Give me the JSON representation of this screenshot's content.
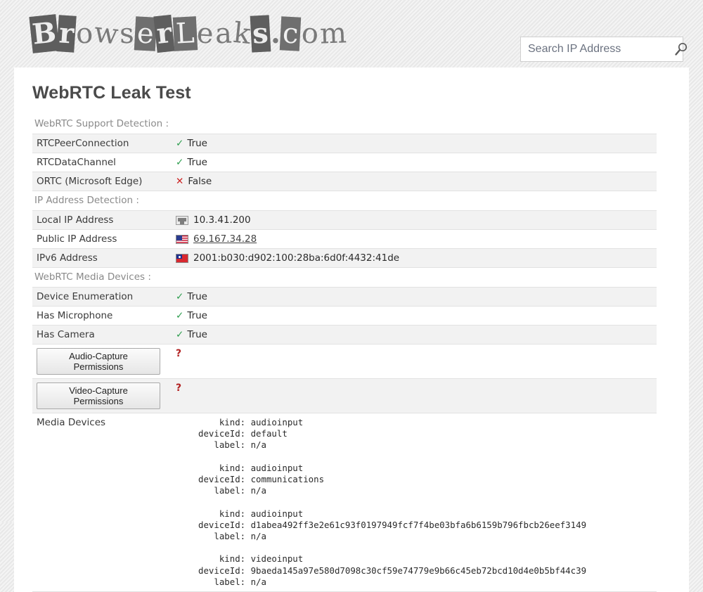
{
  "header": {
    "logo_text": "BrowserLeaks.com",
    "logo_chars": [
      "B",
      "r",
      "o",
      "w",
      "s",
      "e",
      "r",
      "L",
      "e",
      "a",
      "k",
      "s",
      ".",
      "c",
      "o",
      "m"
    ],
    "search": {
      "placeholder": "Search IP Address",
      "value": "",
      "icon": "search-icon"
    }
  },
  "main": {
    "title": "WebRTC Leak Test",
    "sections": [
      {
        "label": "WebRTC Support Detection :",
        "rows": [
          {
            "key": "RTCPeerConnection",
            "status": "true",
            "value": "True"
          },
          {
            "key": "RTCDataChannel",
            "status": "true",
            "value": "True"
          },
          {
            "key": "ORTC (Microsoft Edge)",
            "status": "false",
            "value": "False"
          }
        ]
      },
      {
        "label": "IP Address Detection :",
        "rows": [
          {
            "key": "Local IP Address",
            "icon": "lan-icon",
            "value": "10.3.41.200",
            "link": false
          },
          {
            "key": "Public IP Address",
            "icon": "flag-us-icon",
            "value": "69.167.34.28",
            "link": true
          },
          {
            "key": "IPv6 Address",
            "icon": "flag-tw-icon",
            "value": "2001:b030:d902:100:28ba:6d0f:4432:41de",
            "link": false
          }
        ]
      },
      {
        "label": "WebRTC Media Devices :",
        "rows": [
          {
            "key": "Device Enumeration",
            "status": "true",
            "value": "True"
          },
          {
            "key": "Has Microphone",
            "status": "true",
            "value": "True"
          },
          {
            "key": "Has Camera",
            "status": "true",
            "value": "True"
          }
        ]
      }
    ],
    "permissions": [
      {
        "button_label": "Audio-Capture Permissions",
        "status_symbol": "?"
      },
      {
        "button_label": "Video-Capture Permissions",
        "status_symbol": "?"
      }
    ],
    "media_devices": {
      "key": "Media Devices",
      "text": "    kind: audioinput\ndeviceId: default\n   label: n/a\n\n    kind: audioinput\ndeviceId: communications\n   label: n/a\n\n    kind: audioinput\ndeviceId: d1abea492ff3e2e61c93f0197949fcf7f4be03bfa6b6159b796fbcb26eef3149\n   label: n/a\n\n    kind: videoinput\ndeviceId: 9baeda145a97e580d7098c30cf59e74779e9b66c45eb72bcd10d4e0b5bf44c39\n   label: n/a",
      "entries": [
        {
          "kind": "audioinput",
          "deviceId": "default",
          "label": "n/a"
        },
        {
          "kind": "audioinput",
          "deviceId": "communications",
          "label": "n/a"
        },
        {
          "kind": "audioinput",
          "deviceId": "d1abea492ff3e2e61c93f0197949fcf7f4be03bfa6b6159b796fbcb26eef3149",
          "label": "n/a"
        },
        {
          "kind": "videoinput",
          "deviceId": "9baeda145a97e580d7098c30cf59e74779e9b66c45eb72bcd10d4e0b5bf44c39",
          "label": "n/a"
        }
      ]
    }
  },
  "symbols": {
    "check": "✓",
    "cross": "✕"
  },
  "colors": {
    "true_green": "#2e9e4f",
    "false_red": "#cc2222",
    "unknown_red": "#b22222",
    "title": "#4a4a4a",
    "row_gray": "#f2f2f2"
  }
}
